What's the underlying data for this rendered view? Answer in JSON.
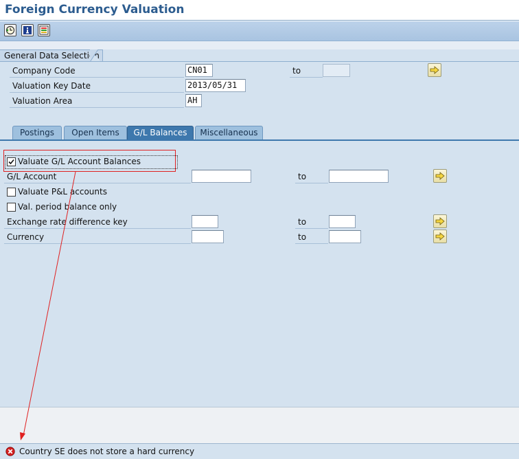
{
  "window": {
    "title": "Foreign Currency Valuation"
  },
  "toolbar": {
    "buttons": [
      {
        "icon": "execute-clock-icon"
      },
      {
        "icon": "info-icon"
      },
      {
        "icon": "variants-icon"
      }
    ]
  },
  "general_data": {
    "section_title": "General Data Selection",
    "company_code": {
      "label": "Company Code",
      "value": "CN01",
      "to_label": "to",
      "to_value": ""
    },
    "valuation_key_date": {
      "label": "Valuation Key Date",
      "value": "2013/05/31"
    },
    "valuation_area": {
      "label": "Valuation Area",
      "value": "AH"
    }
  },
  "tabs": [
    {
      "label": "Postings",
      "active": false
    },
    {
      "label": "Open Items",
      "active": false
    },
    {
      "label": "G/L Balances",
      "active": true
    },
    {
      "label": "Miscellaneous",
      "active": false
    }
  ],
  "gl_balances": {
    "valuate_gl_balances": {
      "label": "Valuate G/L Account Balances",
      "checked": true
    },
    "gl_account": {
      "label": "G/L Account",
      "value": "",
      "to_label": "to",
      "to_value": ""
    },
    "valuate_pl": {
      "label": "Valuate P&L accounts",
      "checked": false
    },
    "period_balance_only": {
      "label": "Val. period balance only",
      "checked": false
    },
    "exchange_rate_diff_key": {
      "label": "Exchange rate difference key",
      "value": "",
      "to_label": "to",
      "to_value": ""
    },
    "currency": {
      "label": "Currency",
      "value": "",
      "to_label": "to",
      "to_value": ""
    }
  },
  "status": {
    "type": "error",
    "message": "Country SE does not store a hard currency"
  },
  "colors": {
    "title": "#2c5c8f",
    "form_bg": "#d4e2ef",
    "active_tab": "#3e78ad",
    "annotation_red": "#e02020"
  }
}
